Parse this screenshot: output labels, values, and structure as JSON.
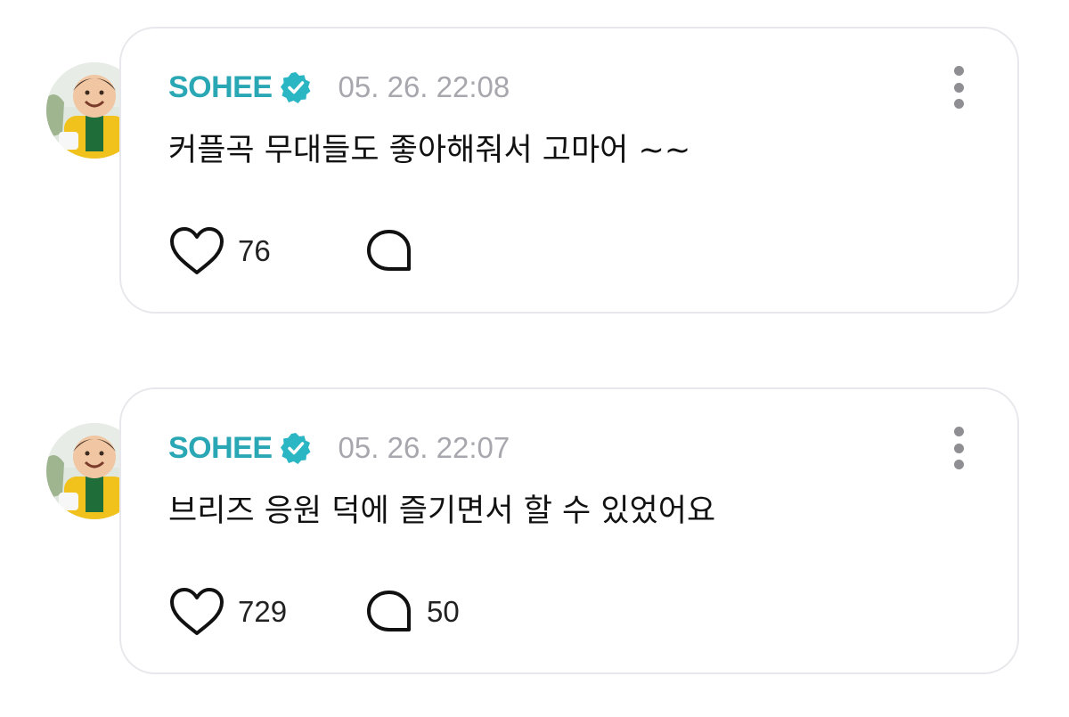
{
  "posts": [
    {
      "author": "SOHEE",
      "timestamp": "05. 26. 22:08",
      "text": "커플곡 무대들도 좋아해줘서 고마어 ~~",
      "likes": "76",
      "comments": ""
    },
    {
      "author": "SOHEE",
      "timestamp": "05. 26. 22:07",
      "text": "브리즈 응원 덕에 즐기면서 할 수 있었어요",
      "likes": "729",
      "comments": "50"
    }
  ],
  "icons": {
    "verified": "verified-badge-icon",
    "more": "more-vertical-icon",
    "like": "heart-outline-icon",
    "comment": "speech-bubble-icon"
  },
  "colors": {
    "author": "#2aa7b4",
    "timestamp": "#a7a7ad",
    "card_border": "#e8e8ec",
    "badge": "#2bb6c4"
  }
}
